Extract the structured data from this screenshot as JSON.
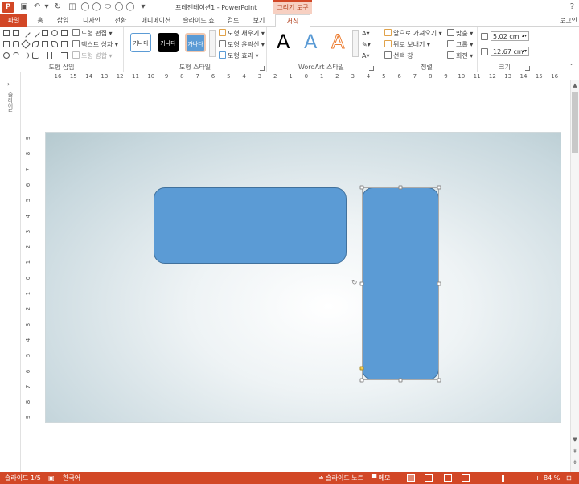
{
  "window": {
    "doc_title": "프레젠테이션1 - PowerPoint",
    "context_tab": "그리기 도구",
    "help_icon": "question-icon",
    "login": "로그인"
  },
  "tabs": [
    {
      "label": "파일"
    },
    {
      "label": "홈"
    },
    {
      "label": "삽입"
    },
    {
      "label": "디자인"
    },
    {
      "label": "전환"
    },
    {
      "label": "애니메이션"
    },
    {
      "label": "슬라이드 쇼"
    },
    {
      "label": "검토"
    },
    {
      "label": "보기"
    },
    {
      "label": "서식"
    }
  ],
  "ribbon": {
    "insert_shapes": {
      "label": "도형 삽입",
      "edit_shape": "도형 편집",
      "text_box": "텍스트 상자",
      "merge_shapes": "도형 병합"
    },
    "shape_styles": {
      "label": "도형 스타일",
      "swatch_text": "가나다",
      "fill": "도형 채우기",
      "outline": "도형 윤곽선",
      "effects": "도형 효과"
    },
    "wordart": {
      "label": "WordArt 스타일",
      "letter": "A"
    },
    "arrange": {
      "label": "정렬",
      "bring_forward": "앞으로 가져오기",
      "send_backward": "뒤로 보내기",
      "selection_pane": "선택 창",
      "align": "맞춤",
      "group": "그룹",
      "rotate": "회전"
    },
    "size": {
      "label": "크기",
      "height": "5.02 cm",
      "width": "12.67 cm"
    }
  },
  "ruler": {
    "h_ticks": [
      "16",
      "15",
      "14",
      "13",
      "12",
      "11",
      "10",
      "9",
      "8",
      "7",
      "6",
      "5",
      "4",
      "3",
      "2",
      "1",
      "0",
      "1",
      "2",
      "3",
      "4",
      "5",
      "6",
      "7",
      "8",
      "9",
      "10",
      "11",
      "12",
      "13",
      "14",
      "15",
      "16"
    ],
    "v_ticks": [
      "9",
      "8",
      "7",
      "6",
      "5",
      "4",
      "3",
      "2",
      "1",
      "0",
      "1",
      "2",
      "3",
      "4",
      "5",
      "6",
      "7",
      "8",
      "9"
    ]
  },
  "left_pane": {
    "label": "슬라이드",
    "arrow": "›"
  },
  "status": {
    "slide": "슬라이드 1/5",
    "language": "한국어",
    "notes": "슬라이드 노트",
    "comments": "메모",
    "zoom": "84 %"
  },
  "colors": {
    "accent": "#d24726",
    "shape_fill": "#5b9bd5",
    "shape_border": "#41719c"
  }
}
